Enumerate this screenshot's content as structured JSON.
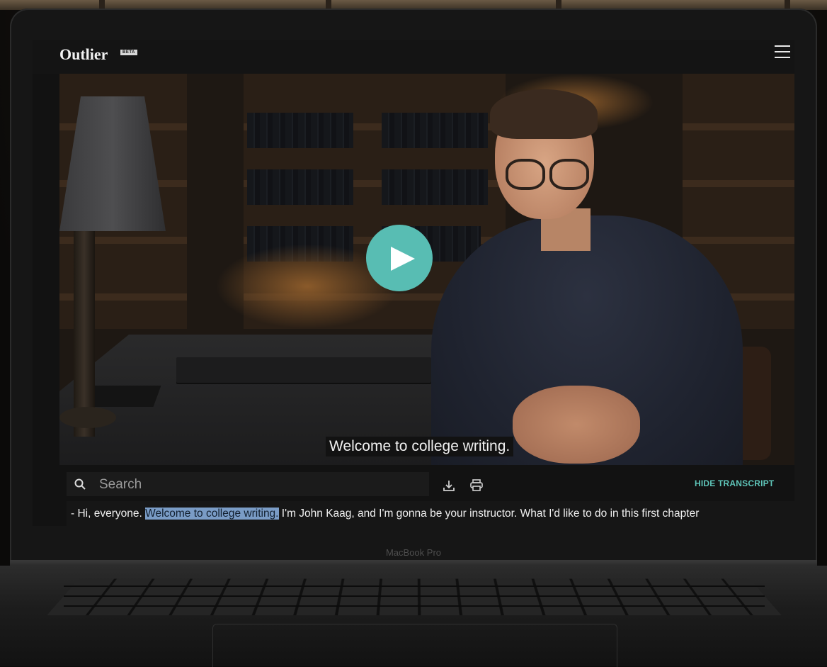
{
  "app": {
    "brand": "Outlier",
    "badge": "BETA"
  },
  "device": {
    "label": "MacBook Pro"
  },
  "video": {
    "caption": "Welcome to college writing.",
    "play_icon": "play-icon"
  },
  "transcript_bar": {
    "search_placeholder": "Search",
    "search_value": "",
    "download_icon": "download-icon",
    "print_icon": "print-icon",
    "hide_label": "HIDE TRANSCRIPT"
  },
  "transcript": {
    "before": "- Hi, everyone. ",
    "highlight": "Welcome to college writing.",
    "after": " I'm John Kaag, and I'm gonna be your instructor. What I'd like to do in this first chapter"
  },
  "colors": {
    "accent": "#58bdb3",
    "link": "#5ec4b8",
    "highlight": "#7a9cc6"
  }
}
